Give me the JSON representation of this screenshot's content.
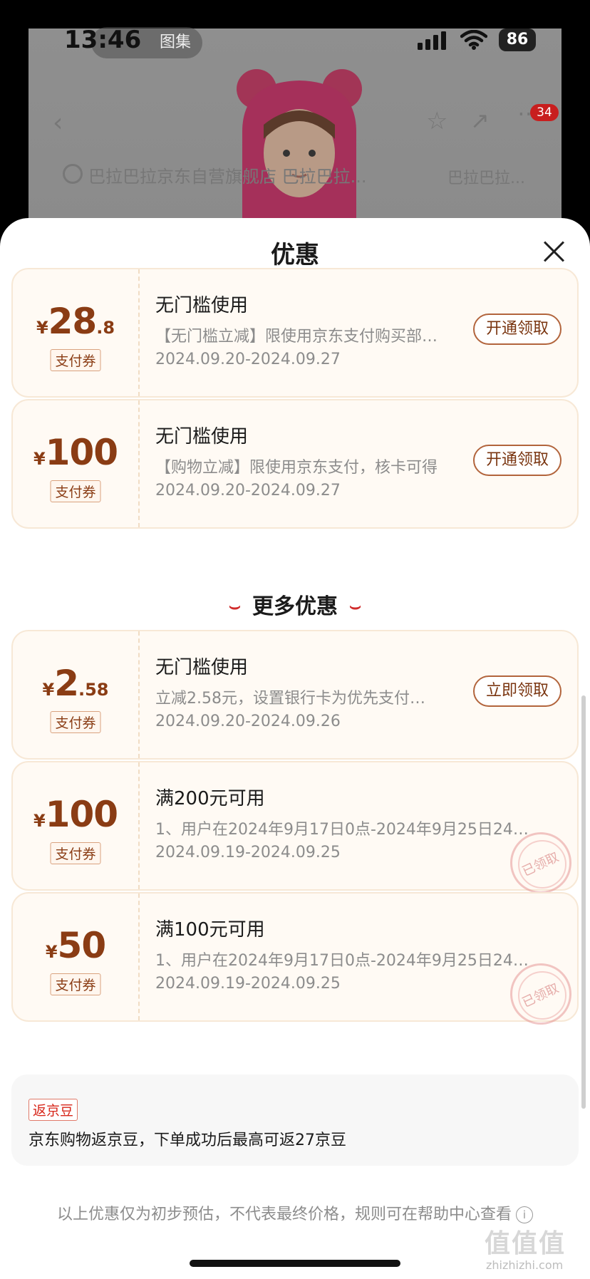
{
  "status_bar": {
    "time": "13:46",
    "gallery_label": "图集",
    "battery": "86"
  },
  "backdrop": {
    "cart_badge": "34",
    "search_text": "巴拉巴拉京东自营旗舰店 巴拉巴拉...",
    "search_text_2": "巴拉巴拉..."
  },
  "sheet": {
    "title": "优惠"
  },
  "coupons": [
    {
      "currency": "¥",
      "amount_int": "28",
      "amount_dec": ".8",
      "tag": "支付券",
      "title": "无门槛使用",
      "desc": "【无门槛立减】限使用京东支付购买部…",
      "date": "2024.09.20-2024.09.27",
      "button": "开通领取"
    },
    {
      "currency": "¥",
      "amount_int": "100",
      "amount_dec": "",
      "tag": "支付券",
      "title": "无门槛使用",
      "desc": "【购物立减】限使用京东支付，核卡可得",
      "date": "2024.09.20-2024.09.27",
      "button": "开通领取"
    }
  ],
  "more_section": {
    "title": "更多优惠"
  },
  "more_coupons": [
    {
      "currency": "¥",
      "amount_int": "2",
      "amount_dec": ".58",
      "tag": "支付券",
      "title": "无门槛使用",
      "desc": "立减2.58元，设置银行卡为优先支付…",
      "date": "2024.09.20-2024.09.26",
      "button": "立即领取"
    },
    {
      "currency": "¥",
      "amount_int": "100",
      "amount_dec": "",
      "tag": "支付券",
      "title": "满200元可用",
      "desc": "1、用户在2024年9月17日0点-2024年9月25日24…",
      "date": "2024.09.19-2024.09.25",
      "stamp": "已领取"
    },
    {
      "currency": "¥",
      "amount_int": "50",
      "amount_dec": "",
      "tag": "支付券",
      "title": "满100元可用",
      "desc": "1、用户在2024年9月17日0点-2024年9月25日24…",
      "date": "2024.09.19-2024.09.25",
      "stamp": "已领取"
    }
  ],
  "jd_beans": {
    "tag": "返京豆",
    "text": "京东购物返京豆，下单成功后最高可返27京豆"
  },
  "footer": {
    "note": "以上优惠仅为初步预估，不代表最终价格，规则可在帮助中心查看",
    "info_icon_glyph": "i"
  },
  "watermark": {
    "top": "值值值",
    "bottom": "zhizhizhi.com"
  }
}
